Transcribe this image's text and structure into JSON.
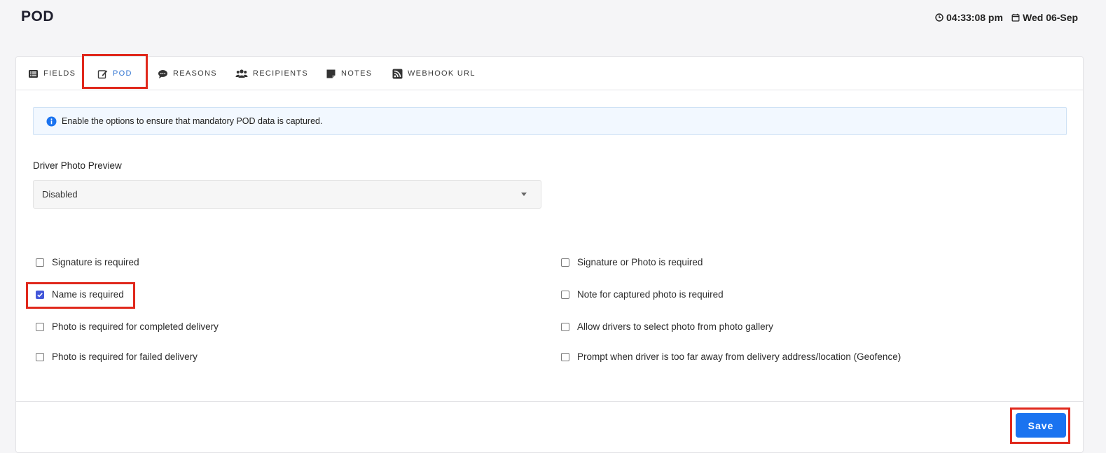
{
  "header": {
    "title": "POD",
    "time": "04:33:08 pm",
    "date": "Wed 06-Sep"
  },
  "tabs": [
    {
      "label": "FIELDS",
      "icon": "list-icon",
      "active": false
    },
    {
      "label": "POD",
      "icon": "edit-icon",
      "active": true
    },
    {
      "label": "REASONS",
      "icon": "comment-icon",
      "active": false
    },
    {
      "label": "RECIPIENTS",
      "icon": "users-icon",
      "active": false
    },
    {
      "label": "NOTES",
      "icon": "note-icon",
      "active": false
    },
    {
      "label": "WEBHOOK URL",
      "icon": "rss-icon",
      "active": false
    }
  ],
  "info_message": "Enable the options to ensure that mandatory POD data is captured.",
  "driver_photo_preview": {
    "label": "Driver Photo Preview",
    "selected": "Disabled"
  },
  "options_left": [
    {
      "label": "Signature is required",
      "checked": false
    },
    {
      "label": "Name is required",
      "checked": true
    },
    {
      "label": "Photo is required for completed delivery",
      "checked": false
    },
    {
      "label": "Photo is required for failed delivery",
      "checked": false
    }
  ],
  "options_right": [
    {
      "label": "Signature or Photo is required",
      "checked": false
    },
    {
      "label": "Note for captured photo is required",
      "checked": false
    },
    {
      "label": "Allow drivers to select photo from photo gallery",
      "checked": false
    },
    {
      "label": "Prompt when driver is too far away from delivery address/location (Geofence)",
      "checked": false
    }
  ],
  "save_label": "Save",
  "colors": {
    "accent": "#1a73f0",
    "active_tab": "#2f73d1",
    "checkbox": "#4357d9",
    "highlight": "#e0281c"
  }
}
